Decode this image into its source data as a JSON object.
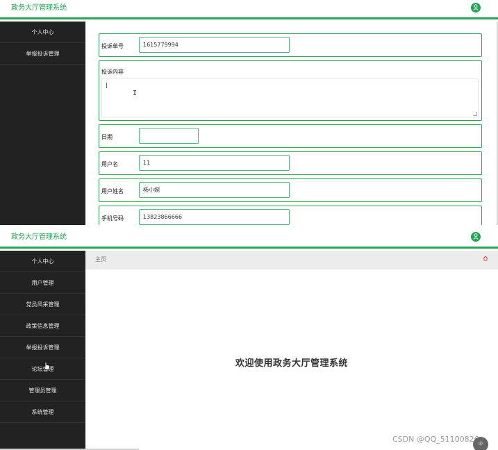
{
  "app": {
    "title": "政务大厅管理系统",
    "accent_color": "#23a455"
  },
  "top_panel": {
    "sidebar": {
      "items": [
        {
          "label": "个人中心"
        },
        {
          "label": "举报投诉管理"
        }
      ]
    },
    "form": {
      "complaint_number": {
        "label": "投诉单号",
        "value": "1615779994"
      },
      "complaint_content": {
        "label": "投诉内容",
        "value": ""
      },
      "date": {
        "label": "日期",
        "value": ""
      },
      "username": {
        "label": "用户名",
        "value": "11"
      },
      "user_name": {
        "label": "用户姓名",
        "value": "杨小婉"
      },
      "phone": {
        "label": "手机号码",
        "value": "13823866666"
      }
    }
  },
  "bottom_panel": {
    "sidebar": {
      "items": [
        {
          "label": "个人中心"
        },
        {
          "label": "用户管理"
        },
        {
          "label": "党员风采管理"
        },
        {
          "label": "政策信息管理"
        },
        {
          "label": "举报投诉管理"
        },
        {
          "label": "论坛管理"
        },
        {
          "label": "管理员管理"
        },
        {
          "label": "系统管理"
        }
      ]
    },
    "breadcrumb": {
      "current": "主页"
    },
    "welcome_text": "欢迎使用政务大厅管理系统",
    "watermark": "CSDN @QQ_51100826",
    "float_button_text": "中"
  },
  "icons": {
    "avatar": "user-avatar-icon",
    "home": "home-icon",
    "cursor": "hand-pointer-icon"
  }
}
